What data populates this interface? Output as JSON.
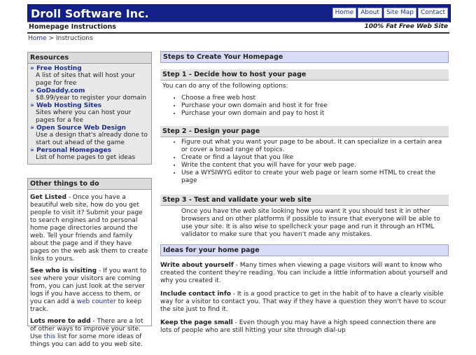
{
  "header": {
    "site_title": "Droll Software Inc.",
    "nav": [
      "Home",
      "About",
      "Site Map",
      "Contact"
    ]
  },
  "subbar": {
    "left": "Homepage Instructions",
    "right": "100% Fat Free Web Site"
  },
  "breadcrumb": {
    "home": "Home",
    "sep": " > ",
    "current": "Instructions"
  },
  "resources": {
    "title": "Resources",
    "items": [
      {
        "title": "Free Hosting",
        "desc": "A list of sites that will host your page for free"
      },
      {
        "title": "GoDaddy.com",
        "desc": "$8.99/year to register your domain"
      },
      {
        "title": "Web Hosting Sites",
        "desc": "Sites where you can host your pages for a fee"
      },
      {
        "title": "Open Source Web Design",
        "desc": "Use a design that's already done to start out ahead of the game"
      },
      {
        "title": "Personal Homepages",
        "desc": "List of home pages to get ideas"
      }
    ]
  },
  "other": {
    "title": "Other things to do",
    "p1_b": "Get Listed",
    "p1": " - Once you have a beautiful web site, how do you get people to visit it? Submit your page to search engines and to personal home page directories around the web. Tell your friends and family about the page and if they have pages on the web ask them to create links to yours.",
    "p2_b": "See who is visiting",
    "p2a": " - If you want to see where your visitors are coming from, you can just look at the server logs if you have access to them, or you can add a ",
    "p2_link": "web counter",
    "p2b": " to keep track.",
    "p3_b": "Lots more to add",
    "p3a": " - There are a lot of other ways to improve your site. Use ",
    "p3_link": "this",
    "p3b": " list for some more ideas of things you can add to you web site."
  },
  "main": {
    "steps_title": "Steps to Create Your Homepage",
    "step1": {
      "title": "Step 1 - Decide how to host your page",
      "intro": "You can do any of the following options:",
      "items": [
        "Choose a free web host",
        "Purchase your own domain and host it for free",
        "Purchase your own domain and pay to host it"
      ]
    },
    "step2": {
      "title": "Step 2 - Design your page",
      "items": [
        "Figure out what you want your page to be about. It can specialize in a certain area or cover a broad range of topics.",
        "Create or find a layout that you like",
        "Write the content that you will have for your web page.",
        "Use a WYSIWYG editor to create your web page or learn some HTML to creat the page"
      ]
    },
    "step3": {
      "title": "Step 3 - Test and validate your web site",
      "text": "Once you have the web site looking how you want it you should test it in other browsers and on other platforms if possible to insure that everyone will be able to use your site. It is also wise to spellcheck your page and run it through an HTML validator to make sure that you haven't made any mistakes."
    },
    "ideas": {
      "title": "Ideas for your home page",
      "i1_b": "Write about yourself",
      "i1": " - Many times when viewing a page visitors will want to know who created the content they're reading. You can include a little information about yourself and why you created it.",
      "i2_b": "Include contact info",
      "i2": " - It is a good practice to get in the habit of to have a clearly visible way for a visitor to contact you. That way if they have a question they won't have to scour the site just to find it.",
      "i3_b": "Keep the page small",
      "i3": " - Even though you may have a high speed connection there are lots of people who are still hitting your site through dial-up"
    }
  }
}
